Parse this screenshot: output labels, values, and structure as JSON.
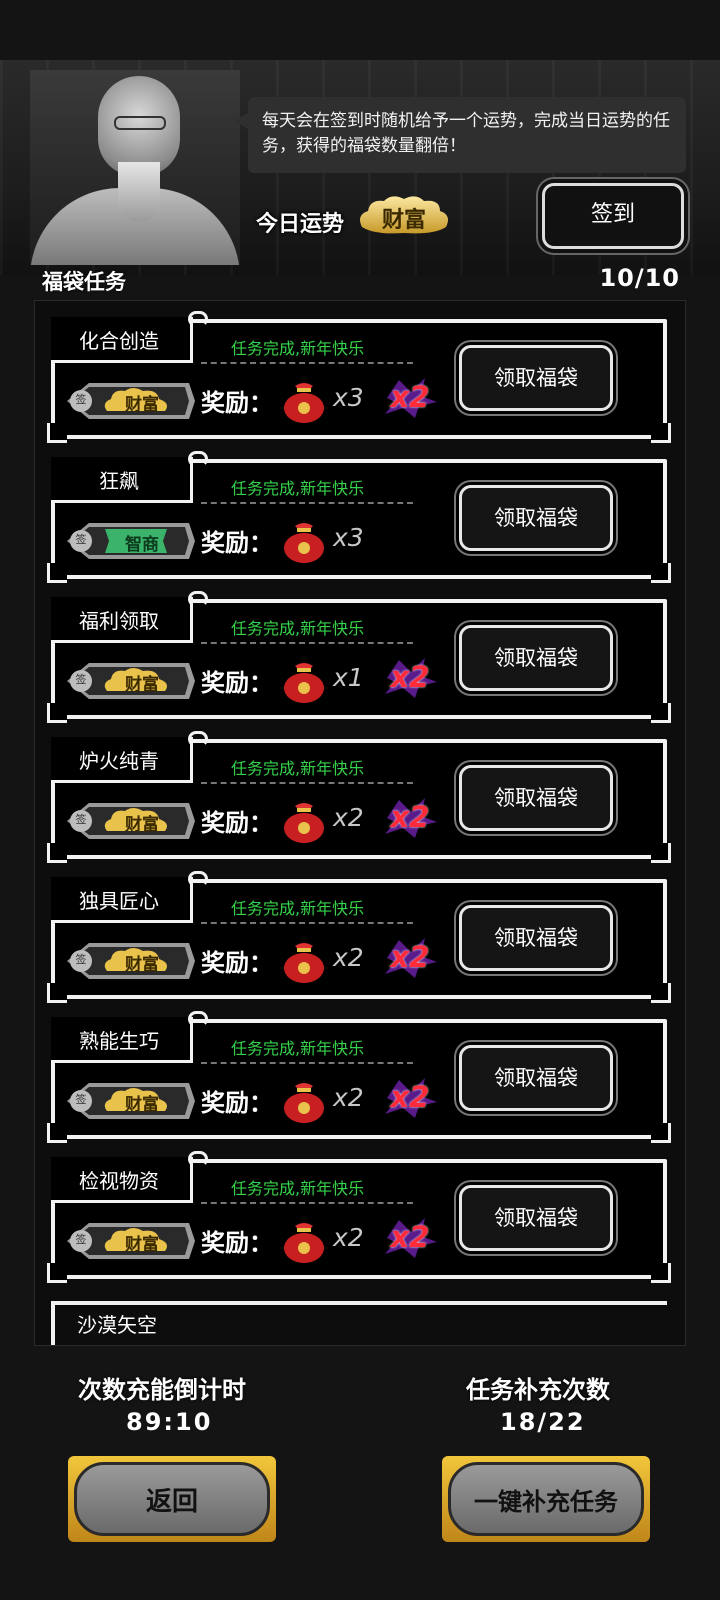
{
  "header": {
    "tip_text": "每天会在签到时随机给予一个运势，完成当日运势的任务，获得的福袋数量翻倍！",
    "today_fortune_label": "今日运势",
    "today_fortune_value": "财富",
    "signin_label": "签到"
  },
  "tasks_section": {
    "title": "福袋任务",
    "count": "10/10"
  },
  "tasks": [
    {
      "name": "化合创造",
      "status": "任务完成,新年快乐",
      "fortune_tag": "财富",
      "sign_char": "签",
      "reward_label": "奖励：",
      "quantity": "x3",
      "multiplier": "x2",
      "claim_label": "领取福袋"
    },
    {
      "name": "狂飙",
      "status": "任务完成,新年快乐",
      "fortune_tag": "智商",
      "sign_char": "签",
      "reward_label": "奖励：",
      "quantity": "x3",
      "multiplier": "",
      "claim_label": "领取福袋"
    },
    {
      "name": "福利领取",
      "status": "任务完成,新年快乐",
      "fortune_tag": "财富",
      "sign_char": "签",
      "reward_label": "奖励：",
      "quantity": "x1",
      "multiplier": "x2",
      "claim_label": "领取福袋"
    },
    {
      "name": "炉火纯青",
      "status": "任务完成,新年快乐",
      "fortune_tag": "财富",
      "sign_char": "签",
      "reward_label": "奖励：",
      "quantity": "x2",
      "multiplier": "x2",
      "claim_label": "领取福袋"
    },
    {
      "name": "独具匠心",
      "status": "任务完成,新年快乐",
      "fortune_tag": "财富",
      "sign_char": "签",
      "reward_label": "奖励：",
      "quantity": "x2",
      "multiplier": "x2",
      "claim_label": "领取福袋"
    },
    {
      "name": "熟能生巧",
      "status": "任务完成,新年快乐",
      "fortune_tag": "财富",
      "sign_char": "签",
      "reward_label": "奖励：",
      "quantity": "x2",
      "multiplier": "x2",
      "claim_label": "领取福袋"
    },
    {
      "name": "检视物资",
      "status": "任务完成,新年快乐",
      "fortune_tag": "财富",
      "sign_char": "签",
      "reward_label": "奖励：",
      "quantity": "x2",
      "multiplier": "x2",
      "claim_label": "领取福袋"
    }
  ],
  "partial_task_name": "沙漠矢空",
  "footer": {
    "countdown_label": "次数充能倒计时",
    "countdown_value": "89:10",
    "refill_label": "任务补充次数",
    "refill_value": "18/22",
    "back_label": "返回",
    "refill_all_label": "一键补充任务"
  },
  "colors": {
    "done_green": "#35d24a",
    "wealth_gold": "#e8c24a",
    "iq_green": "#3bb36a",
    "multiplier_red": "#ff2a3a",
    "button_gold": "#f1c63b"
  },
  "icons": {
    "bag": "lucky-bag-icon",
    "signin": "sign-icon"
  }
}
